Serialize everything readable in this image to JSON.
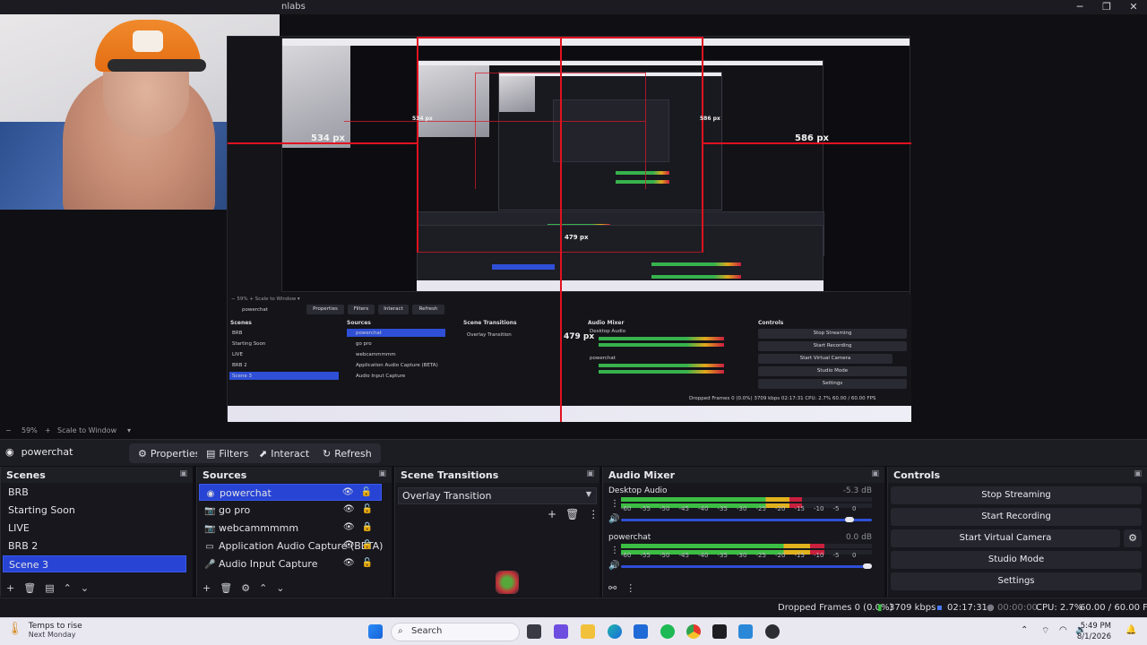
{
  "window": {
    "title_fragment": "nlabs"
  },
  "preview": {
    "labels": {
      "left_px": "534 px",
      "right_px": "586 px",
      "bottom_px": "479 px",
      "inner_left": "534 px",
      "inner_right": "586 px",
      "inner_bottom": "479 px"
    },
    "zoom": {
      "minus": "−",
      "value": "59%",
      "plus": "+",
      "scale_mode": "Scale to Window"
    },
    "inner": {
      "source": "powerchat",
      "buttons": [
        "Properties",
        "Filters",
        "Interact",
        "Refresh"
      ],
      "scenes_title": "Scenes",
      "sources_title": "Sources",
      "transitions_title": "Scene Transitions",
      "mixer_title": "Audio Mixer",
      "controls_title": "Controls",
      "status": "Dropped Frames 0 (0.0%)   3709 kbps   02:17:31   CPU: 2.7%   60.00 / 60.00 FPS"
    }
  },
  "context": {
    "source_name": "powerchat",
    "buttons": {
      "properties": "Properties",
      "filters": "Filters",
      "interact": "Interact",
      "refresh": "Refresh"
    }
  },
  "scenes": {
    "title": "Scenes",
    "items": [
      "BRB",
      "Starting Soon",
      "LIVE",
      "BRB 2",
      "Scene 3"
    ],
    "selected_index": 4
  },
  "sources": {
    "title": "Sources",
    "items": [
      {
        "name": "powerchat",
        "icon": "browser-icon",
        "selected": true
      },
      {
        "name": "go pro",
        "icon": "camera-icon"
      },
      {
        "name": "webcammmmm",
        "icon": "camera-icon"
      },
      {
        "name": "Application Audio Capture (BETA)",
        "icon": "window-icon"
      },
      {
        "name": "Audio Input Capture",
        "icon": "microphone-icon"
      }
    ]
  },
  "transitions": {
    "title": "Scene Transitions",
    "selected": "Overlay Transition"
  },
  "mixer": {
    "title": "Audio Mixer",
    "channels": [
      {
        "name": "Desktop Audio",
        "db": "-5.3 dB",
        "level": 0.72,
        "fader": 0.93
      },
      {
        "name": "powerchat",
        "db": "0.0 dB",
        "level": 0.81,
        "fader": 1.0
      }
    ],
    "scale": [
      "-60",
      "-55",
      "-50",
      "-45",
      "-40",
      "-35",
      "-30",
      "-25",
      "-20",
      "-15",
      "-10",
      "-5",
      "0"
    ],
    "colors": {
      "green": "#3cbd43",
      "yellow": "#e2b21c",
      "red": "#c9203d"
    }
  },
  "controls": {
    "title": "Controls",
    "buttons": [
      "Stop Streaming",
      "Start Recording",
      "Start Virtual Camera",
      "Studio Mode",
      "Settings"
    ]
  },
  "status": {
    "dropped": "Dropped Frames 0 (0.0%)",
    "kbps": "3709 kbps",
    "stream_time": "02:17:31",
    "rec_time": "00:00:00",
    "cpu": "CPU: 2.7%",
    "fps": "60.00 / 60.00 FPS"
  },
  "taskbar": {
    "weather_title": "Temps to rise",
    "weather_sub": "Next Monday",
    "search_placeholder": "Search",
    "time": "5:49 PM",
    "date": "8/1/2026"
  },
  "accent": "#2744d4"
}
